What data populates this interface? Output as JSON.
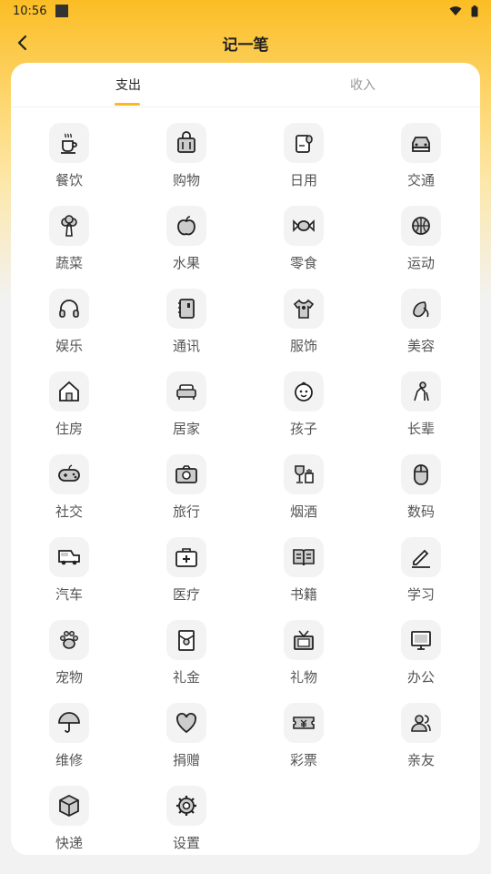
{
  "status_bar": {
    "time": "10:56"
  },
  "header": {
    "title": "记一笔"
  },
  "tabs": [
    {
      "label": "支出",
      "active": true
    },
    {
      "label": "收入",
      "active": false
    }
  ],
  "accent_color": "#fbb824",
  "categories": [
    {
      "label": "餐饮",
      "icon": "coffee-cup-icon"
    },
    {
      "label": "购物",
      "icon": "shopping-bag-icon"
    },
    {
      "label": "日用",
      "icon": "tissue-roll-icon"
    },
    {
      "label": "交通",
      "icon": "car-front-icon"
    },
    {
      "label": "蔬菜",
      "icon": "broccoli-icon"
    },
    {
      "label": "水果",
      "icon": "apple-icon"
    },
    {
      "label": "零食",
      "icon": "candy-icon"
    },
    {
      "label": "运动",
      "icon": "basketball-icon"
    },
    {
      "label": "娱乐",
      "icon": "headphones-icon"
    },
    {
      "label": "通讯",
      "icon": "phone-book-icon"
    },
    {
      "label": "服饰",
      "icon": "tshirt-icon"
    },
    {
      "label": "美容",
      "icon": "beauty-icon"
    },
    {
      "label": "住房",
      "icon": "house-icon"
    },
    {
      "label": "居家",
      "icon": "sofa-icon"
    },
    {
      "label": "孩子",
      "icon": "baby-face-icon"
    },
    {
      "label": "长辈",
      "icon": "elder-icon"
    },
    {
      "label": "社交",
      "icon": "gamepad-icon"
    },
    {
      "label": "旅行",
      "icon": "camera-icon"
    },
    {
      "label": "烟酒",
      "icon": "wine-cigarette-icon"
    },
    {
      "label": "数码",
      "icon": "mouse-icon"
    },
    {
      "label": "汽车",
      "icon": "van-icon"
    },
    {
      "label": "医疗",
      "icon": "medical-kit-icon"
    },
    {
      "label": "书籍",
      "icon": "open-book-icon"
    },
    {
      "label": "学习",
      "icon": "pencil-icon"
    },
    {
      "label": "宠物",
      "icon": "paw-icon"
    },
    {
      "label": "礼金",
      "icon": "red-envelope-icon"
    },
    {
      "label": "礼物",
      "icon": "gift-tv-icon"
    },
    {
      "label": "办公",
      "icon": "monitor-icon"
    },
    {
      "label": "维修",
      "icon": "umbrella-icon"
    },
    {
      "label": "捐赠",
      "icon": "heart-icon"
    },
    {
      "label": "彩票",
      "icon": "lottery-ticket-icon"
    },
    {
      "label": "亲友",
      "icon": "friends-icon"
    },
    {
      "label": "快递",
      "icon": "package-box-icon"
    },
    {
      "label": "设置",
      "icon": "gear-icon"
    }
  ]
}
